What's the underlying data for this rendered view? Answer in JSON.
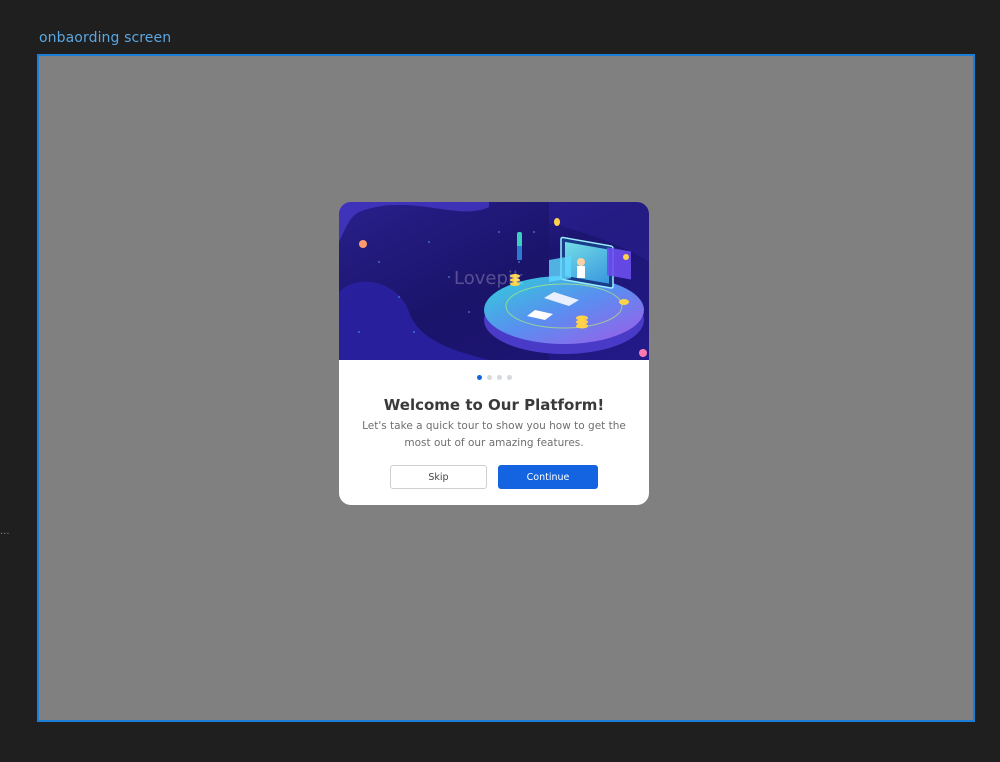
{
  "canvas": {
    "frame_label": "onbaording screen",
    "side_indicator": "..."
  },
  "modal": {
    "hero_image": "isometric-platform-illustration",
    "hero_watermark": "Lovepik",
    "pager": {
      "total": 4,
      "active_index": 0
    },
    "title": "Welcome to Our Platform!",
    "description": "Let's take a quick tour to show you how to get the most out of our amazing features.",
    "skip_label": "Skip",
    "continue_label": "Continue"
  },
  "colors": {
    "canvas_bg": "#1f1f1f",
    "frame_bg": "#808080",
    "frame_border": "#1b7fd8",
    "primary": "#1463e0",
    "hero_dark": "#1a1466"
  }
}
